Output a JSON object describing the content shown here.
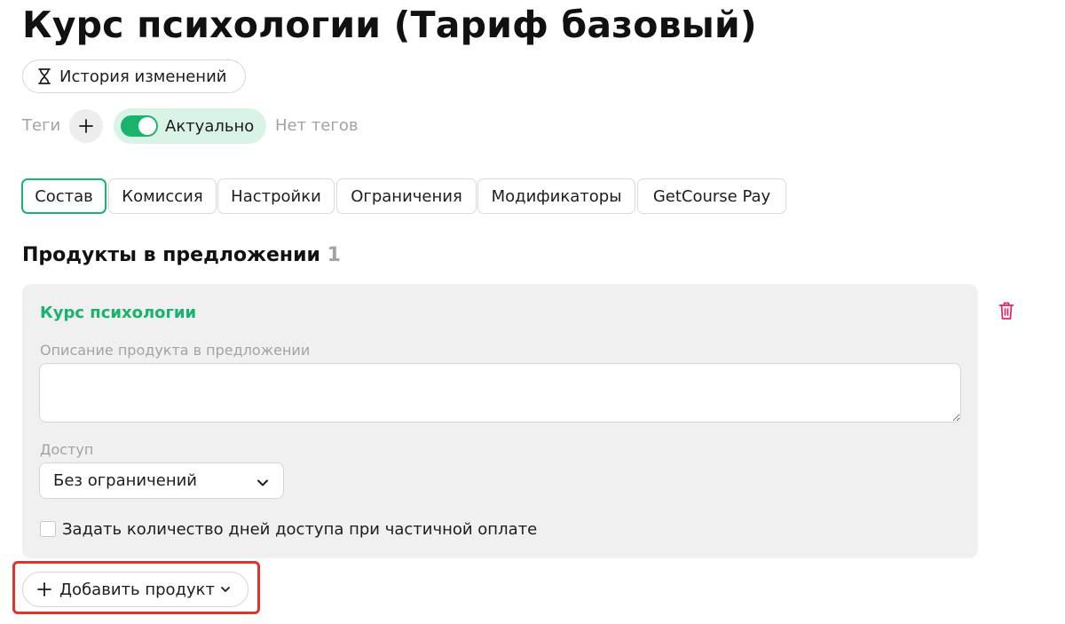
{
  "header": {
    "title": "Курс психологии (Тариф базовый)",
    "history_button": "История изменений"
  },
  "tags": {
    "label": "Теги",
    "status_label": "Актуально",
    "status_on": true,
    "no_tags_text": "Нет тегов"
  },
  "tabs": [
    {
      "label": "Состав",
      "active": true
    },
    {
      "label": "Комиссия",
      "active": false
    },
    {
      "label": "Настройки",
      "active": false
    },
    {
      "label": "Ограничения",
      "active": false
    },
    {
      "label": "Модификаторы",
      "active": false
    },
    {
      "label": "GetCourse Pay",
      "active": false
    }
  ],
  "products_section": {
    "title": "Продукты в предложении",
    "count": "1"
  },
  "product": {
    "name": "Курс психологии",
    "description_label": "Описание продукта в предложении",
    "description_value": "",
    "access_label": "Доступ",
    "access_value": "Без ограничений",
    "partial_payment_checkbox_label": "Задать количество дней доступа при частичной оплате",
    "partial_payment_checked": false
  },
  "add_product_button": "Добавить продукт",
  "colors": {
    "accent": "#19b36e",
    "accent_bg": "#d9f3e6",
    "danger": "#e5312b",
    "trash": "#e0245e",
    "muted": "#a3a3a3"
  },
  "icons": [
    "hourglass-icon",
    "plus-icon",
    "toggle-switch",
    "trash-icon",
    "chevron-down-icon"
  ]
}
